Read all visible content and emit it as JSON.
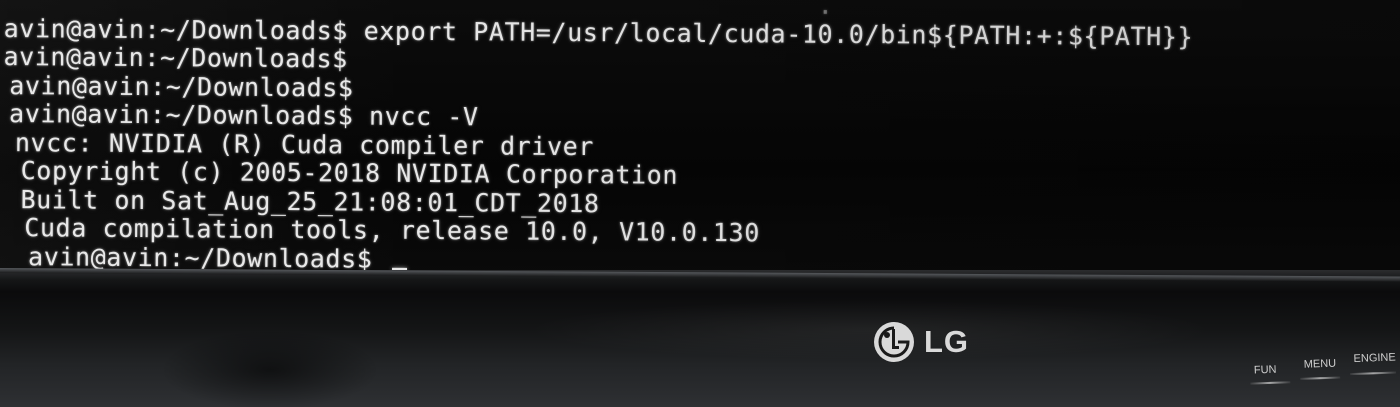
{
  "terminal": {
    "lines": [
      "avin@avin:~/Downloads$ export PATH=/usr/local/cuda-10.0/bin${PATH:+:${PATH}}",
      "avin@avin:~/Downloads$",
      "avin@avin:~/Downloads$",
      "avin@avin:~/Downloads$ nvcc -V",
      "nvcc: NVIDIA (R) Cuda compiler driver",
      "Copyright (c) 2005-2018 NVIDIA Corporation",
      "Built on Sat_Aug_25_21:08:01_CDT_2018",
      "Cuda compilation tools, release 10.0, V10.0.130",
      "avin@avin:~/Downloads$ "
    ]
  },
  "monitor": {
    "brand": "LG",
    "buttons": [
      "FUN",
      "MENU",
      "ENGINE"
    ]
  },
  "colors": {
    "terminal_text": "#e8e8e8",
    "terminal_bg": "#050505",
    "bezel": "#151617"
  }
}
